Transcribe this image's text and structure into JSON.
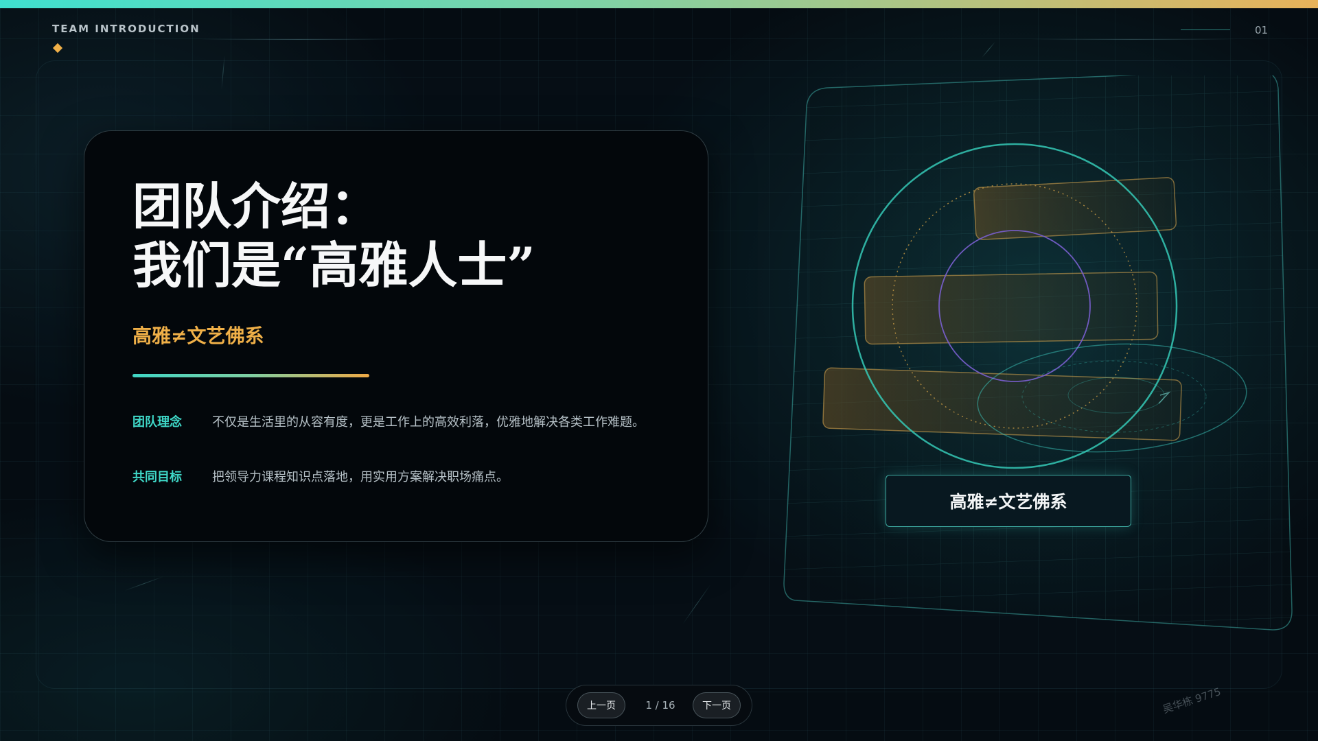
{
  "header": {
    "label": "TEAM INTRODUCTION",
    "page_index": "01"
  },
  "card": {
    "title_line1": "团队介绍：",
    "title_line2": "我们是“高雅人士”",
    "subtitle": "高雅≠文艺佛系",
    "rows": [
      {
        "label": "团队理念",
        "text": "不仅是生活里的从容有度，更是工作上的高效利落，优雅地解决各类工作难题。"
      },
      {
        "label": "共同目标",
        "text": "把领导力课程知识点落地，用实用方案解决职场痛点。"
      }
    ]
  },
  "visual": {
    "badge": "高雅≠文艺佛系"
  },
  "pager": {
    "prev_label": "上一页",
    "count": "1 / 16",
    "next_label": "下一页"
  },
  "watermark": "吴华栋 9775",
  "colors": {
    "accent_teal": "#3fd8c8",
    "accent_gold": "#f0b048",
    "accent_purple": "#7a5fd0",
    "background": "#03080d"
  }
}
